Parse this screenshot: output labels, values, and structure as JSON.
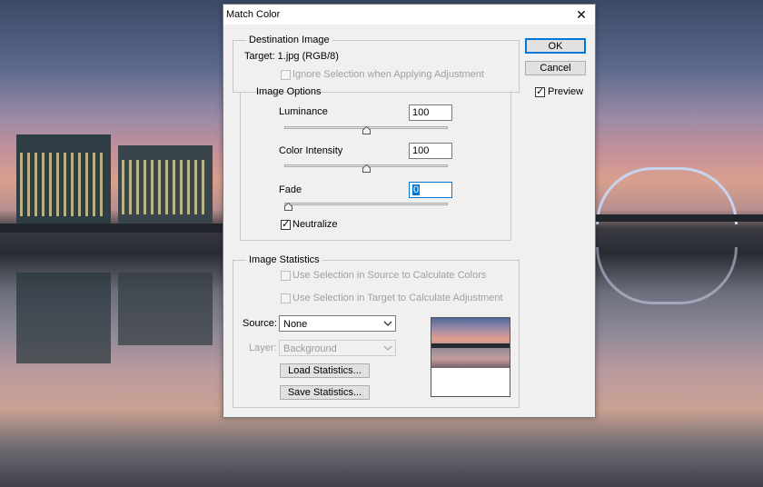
{
  "window": {
    "title": "Match Color",
    "close_glyph": "✕"
  },
  "destination": {
    "legend": "Destination Image",
    "target_text": "Target:  1.jpg (RGB/8)",
    "ignore_selection_label": "Ignore Selection when Applying Adjustment",
    "ignore_selection_checked": false
  },
  "image_options": {
    "legend": "Image Options",
    "luminance": {
      "label": "Luminance",
      "value": "100",
      "slider_fraction": 0.5
    },
    "color_intensity": {
      "label": "Color Intensity",
      "value": "100",
      "slider_fraction": 0.5
    },
    "fade": {
      "label": "Fade",
      "value": "0",
      "slider_fraction": 0.0
    },
    "neutralize": {
      "label": "Neutralize",
      "checked": true
    }
  },
  "statistics": {
    "legend": "Image Statistics",
    "use_source_label": "Use Selection in Source to Calculate Colors",
    "use_target_label": "Use Selection in Target to Calculate Adjustment",
    "source_label": "Source:",
    "source_value": "None",
    "layer_label": "Layer:",
    "layer_value": "Background",
    "load_button": "Load Statistics...",
    "save_button": "Save Statistics..."
  },
  "actions": {
    "ok_label": "OK",
    "cancel_label": "Cancel",
    "preview_label": "Preview",
    "preview_checked": true
  },
  "icons": {
    "check": "check-icon",
    "dropdown": "chevron-down-icon",
    "close": "close-icon"
  },
  "colors": {
    "accent": "#0078d7",
    "dialog_bg": "#f0f0f0",
    "disabled_text": "#a0a0a0"
  }
}
